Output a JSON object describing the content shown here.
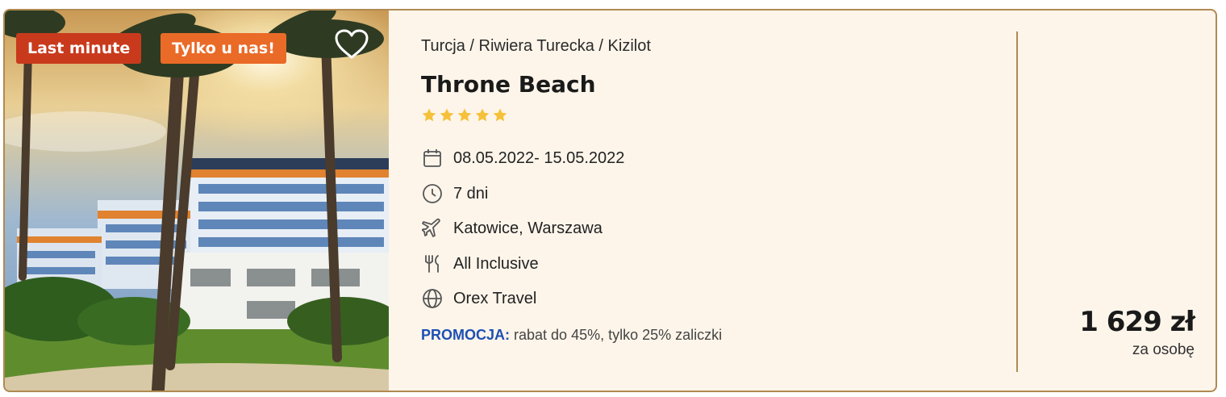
{
  "badges": {
    "last_minute": "Last minute",
    "exclusive": "Tylko u nas!"
  },
  "offer": {
    "breadcrumb": "Turcja / Riwiera Turecka / Kizilot",
    "hotel_name": "Throne Beach",
    "stars": 5,
    "dates": "08.05.2022- 15.05.2022",
    "duration": "7 dni",
    "departure": "Katowice, Warszawa",
    "board": "All Inclusive",
    "operator": "Orex Travel",
    "promo_label": "PROMOCJA:",
    "promo_text": " rabat do 45%, tylko 25% zaliczki",
    "price": "1 629 zł",
    "price_note": "za osobę"
  },
  "icons": {
    "favorite": "heart-outline-icon",
    "dates": "calendar-icon",
    "duration": "clock-icon",
    "departure": "airplane-icon",
    "board": "cutlery-icon",
    "operator": "globe-icon"
  },
  "colors": {
    "card_bg": "#fdf5ea",
    "border": "#b08a52",
    "badge_last_minute": "#c93a1d",
    "badge_exclusive": "#ea6a27",
    "star": "#f5c13a",
    "promo": "#1e4fb4"
  }
}
